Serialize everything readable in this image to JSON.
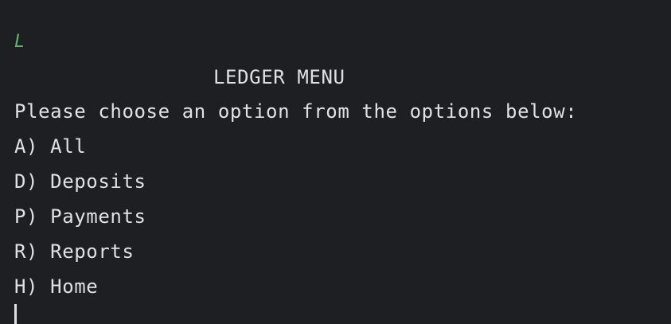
{
  "terminal": {
    "echoed_input": "L",
    "menu_title": "LEDGER MENU",
    "prompt": "Please choose an option from the options below:",
    "options": [
      {
        "label": "A) All"
      },
      {
        "label": "D) Deposits"
      },
      {
        "label": "P) Payments"
      },
      {
        "label": "R) Reports"
      },
      {
        "label": "H) Home"
      }
    ]
  },
  "colors": {
    "background": "#1e1f22",
    "text": "#dfe1e5",
    "input_echo": "#5fb865"
  }
}
